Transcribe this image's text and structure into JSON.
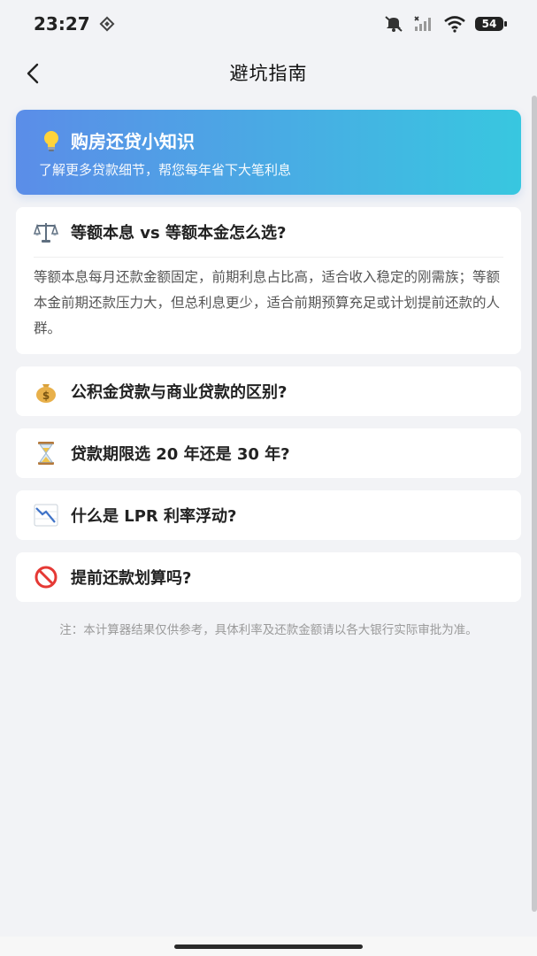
{
  "status": {
    "time": "23:27",
    "battery": "54"
  },
  "nav": {
    "title": "避坑指南"
  },
  "banner": {
    "title": "购房还贷小知识",
    "subtitle": "了解更多贷款细节，帮您每年省下大笔利息",
    "icon": "lightbulb-icon",
    "gradient_start": "#5b8de8",
    "gradient_end": "#38c7e0"
  },
  "tips": [
    {
      "icon": "scales-icon",
      "title": "等额本息 vs 等额本金怎么选?",
      "body": "等额本息每月还款金额固定，前期利息占比高，适合收入稳定的刚需族；等额本金前期还款压力大，但总利息更少，适合前期预算充足或计划提前还款的人群。",
      "expanded": true
    },
    {
      "icon": "money-bag-icon",
      "title": "公积金贷款与商业贷款的区别?",
      "expanded": false
    },
    {
      "icon": "hourglass-icon",
      "title": "贷款期限选 20 年还是 30 年?",
      "expanded": false
    },
    {
      "icon": "chart-decreasing-icon",
      "title": "什么是 LPR 利率浮动?",
      "expanded": false
    },
    {
      "icon": "prohibited-icon",
      "title": "提前还款划算吗?",
      "expanded": false
    }
  ],
  "note": "注：本计算器结果仅供参考，具体利率及还款金额请以各大银行实际审批为准。"
}
